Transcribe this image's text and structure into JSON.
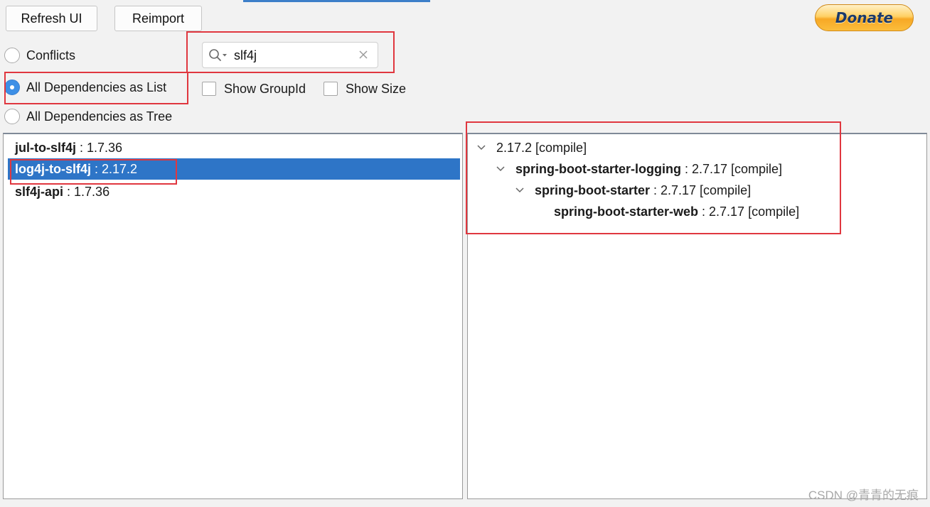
{
  "toolbar": {
    "refresh_label": "Refresh UI",
    "reimport_label": "Reimport",
    "donate_label": "Donate"
  },
  "view_mode": {
    "options": [
      {
        "label": "Conflicts",
        "selected": false
      },
      {
        "label": "All Dependencies as List",
        "selected": true
      },
      {
        "label": "All Dependencies as Tree",
        "selected": false
      }
    ]
  },
  "search": {
    "value": "slf4j",
    "placeholder": "",
    "icon": "search-icon",
    "clear_icon": "close-icon"
  },
  "options": {
    "show_groupid_label": "Show GroupId",
    "show_groupid_checked": false,
    "show_size_label": "Show Size",
    "show_size_checked": false
  },
  "dependency_list": [
    {
      "artifact": "jul-to-slf4j",
      "version": " : 1.7.36",
      "selected": false
    },
    {
      "artifact": "log4j-to-slf4j",
      "version": " : 2.17.2",
      "selected": true
    },
    {
      "artifact": "slf4j-api",
      "version": " : 1.7.36",
      "selected": false
    }
  ],
  "usage_tree": [
    {
      "artifact": "",
      "version": "2.17.2 [compile]",
      "expanded": true
    },
    {
      "artifact": "spring-boot-starter-logging",
      "version": " : 2.7.17 [compile]",
      "expanded": true
    },
    {
      "artifact": "spring-boot-starter",
      "version": " : 2.7.17 [compile]",
      "expanded": true
    },
    {
      "artifact": "spring-boot-starter-web",
      "version": " : 2.7.17 [compile]",
      "expanded": false
    }
  ],
  "watermark": "CSDN @青青的无痕",
  "colors": {
    "selection": "#2e75c7",
    "radio_selected": "#3d8fe6",
    "annotation_box": "#e0373f",
    "donate_text": "#1b3a6b"
  }
}
